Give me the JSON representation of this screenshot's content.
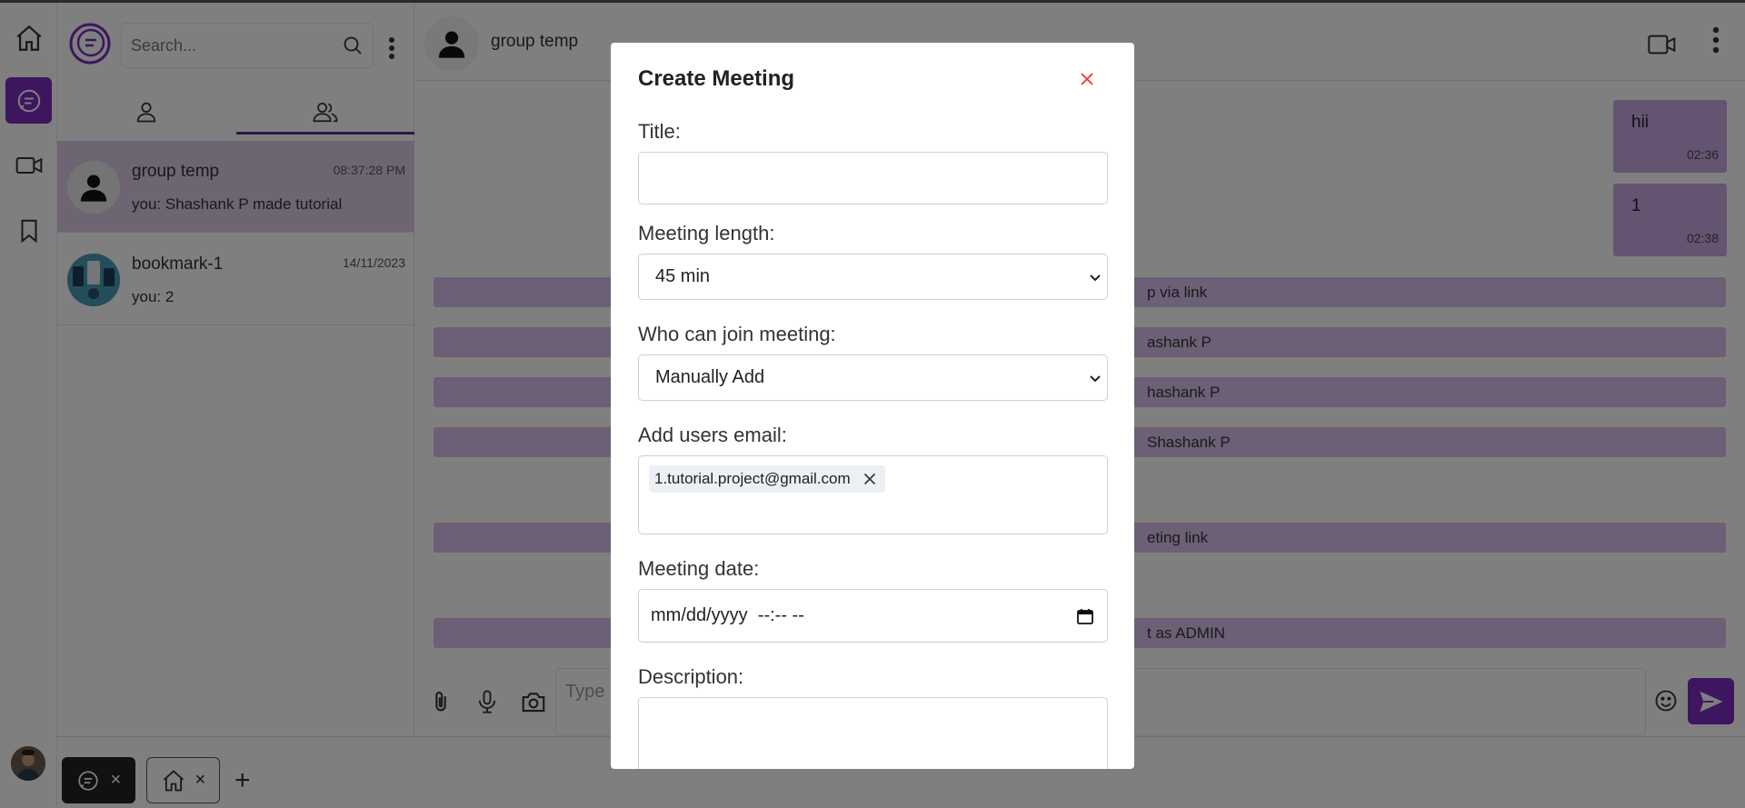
{
  "search": {
    "placeholder": "Search..."
  },
  "rail": {
    "items": [
      {
        "icon": "home-icon"
      },
      {
        "icon": "chat-icon",
        "active": true
      },
      {
        "icon": "video-icon"
      },
      {
        "icon": "bookmark-icon"
      }
    ]
  },
  "tabs": [
    {
      "icon": "person-icon",
      "active": false
    },
    {
      "icon": "group-icon",
      "active": true
    }
  ],
  "conversations": [
    {
      "name": "group temp",
      "time": "08:37:28 PM",
      "preview": "you: Shashank P made tutorial",
      "selected": true
    },
    {
      "name": "bookmark-1",
      "time": "14/11/2023",
      "preview": "you: 2",
      "selected": false
    }
  ],
  "chat": {
    "name": "group temp",
    "messages": [
      {
        "text": "hii",
        "time": "02:36"
      },
      {
        "text": "1",
        "time": "02:38"
      }
    ],
    "system": [
      "p via link",
      "ashank P",
      "hashank P",
      "Shashank P",
      "eting link",
      "t as ADMIN"
    ],
    "composer_placeholder": "Type"
  },
  "taskbar": {
    "tabs": [
      {
        "icon": "chat-icon",
        "active": true
      },
      {
        "icon": "home-icon",
        "active": false
      }
    ],
    "close_glyph": "×",
    "add_glyph": "+"
  },
  "modal": {
    "title": "Create Meeting",
    "fields": {
      "title_label": "Title:",
      "title_value": "",
      "length_label": "Meeting length:",
      "length_value": "45 min",
      "join_label": "Who can join meeting:",
      "join_value": "Manually Add",
      "emails_label": "Add users email:",
      "emails": [
        "1.tutorial.project@gmail.com"
      ],
      "date_label": "Meeting date:",
      "date_placeholder": "mm/dd/yyyy  --:-- --",
      "description_label": "Description:"
    }
  },
  "colors": {
    "accent": "#7b2cbf",
    "bubble": "#c9a9e3",
    "system_strip": "#d7c1ea",
    "selected_conv": "#dccbe6",
    "close_red": "#e53935"
  }
}
